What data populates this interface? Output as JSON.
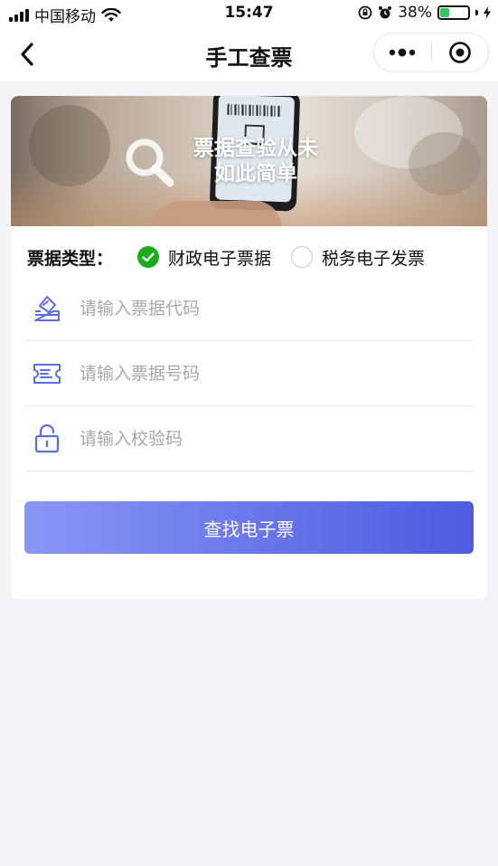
{
  "status_bar": {
    "carrier": "中国移动",
    "time": "15:47",
    "battery_percent": "38%",
    "battery_level": 0.38
  },
  "nav": {
    "title": "手工查票"
  },
  "banner": {
    "line1": "票据查验从未",
    "line2": "如此简单"
  },
  "form": {
    "type_label": "票据类型：",
    "options": [
      {
        "label": "财政电子票据",
        "selected": true
      },
      {
        "label": "税务电子发票",
        "selected": false
      }
    ],
    "code_placeholder": "请输入票据代码",
    "number_placeholder": "请输入票据号码",
    "check_placeholder": "请输入校验码",
    "submit_label": "查找电子票"
  },
  "colors": {
    "selected_radio": "#1aad19",
    "button_gradient_start": "#8b96f6",
    "button_gradient_end": "#4d5cdf",
    "icon_blue": "#5b6ce8"
  }
}
